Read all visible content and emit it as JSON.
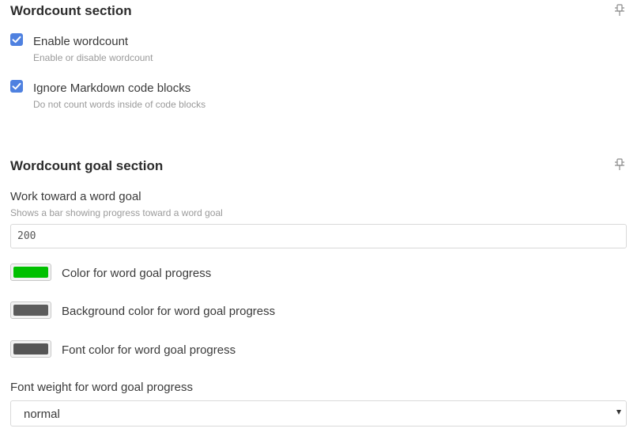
{
  "wordcount_section": {
    "title": "Wordcount section",
    "pin_icon": "pin-icon",
    "options": [
      {
        "label": "Enable wordcount",
        "description": "Enable or disable wordcount",
        "checked": true
      },
      {
        "label": "Ignore Markdown code blocks",
        "description": "Do not count words inside of code blocks",
        "checked": true
      }
    ]
  },
  "goal_section": {
    "title": "Wordcount goal section",
    "pin_icon": "pin-icon",
    "word_goal": {
      "label": "Work toward a word goal",
      "description": "Shows a bar showing progress toward a word goal",
      "value": "200"
    },
    "colors": [
      {
        "label": "Color for word goal progress",
        "color": "#00c000"
      },
      {
        "label": "Background color for word goal progress",
        "color": "#5c5c5c"
      },
      {
        "label": "Font color for word goal progress",
        "color": "#555555"
      }
    ],
    "font_weight": {
      "label": "Font weight for word goal progress",
      "selected": "normal"
    }
  },
  "accent_color": "#4f81e0"
}
